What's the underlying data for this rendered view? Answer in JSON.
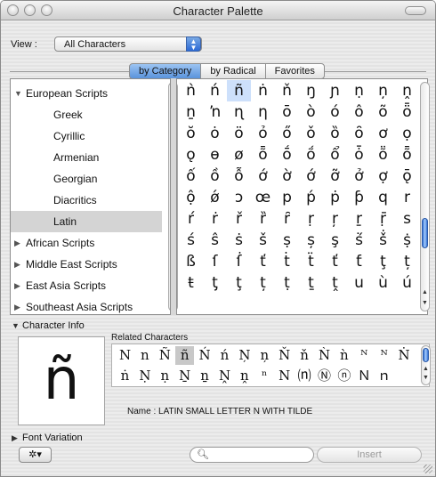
{
  "window": {
    "title": "Character Palette"
  },
  "view": {
    "label": "View :",
    "selected": "All Characters"
  },
  "tabs": [
    {
      "label": "by Category",
      "selected": true
    },
    {
      "label": "by Radical",
      "selected": false
    },
    {
      "label": "Favorites",
      "selected": false
    }
  ],
  "categories": [
    {
      "label": "European Scripts",
      "kind": "group",
      "expanded": true
    },
    {
      "label": "Greek",
      "kind": "child"
    },
    {
      "label": "Cyrillic",
      "kind": "child"
    },
    {
      "label": "Armenian",
      "kind": "child"
    },
    {
      "label": "Georgian",
      "kind": "child"
    },
    {
      "label": "Diacritics",
      "kind": "child"
    },
    {
      "label": "Latin",
      "kind": "child",
      "selected": true
    },
    {
      "label": "African Scripts",
      "kind": "group",
      "expanded": false
    },
    {
      "label": "Middle East Scripts",
      "kind": "group",
      "expanded": false
    },
    {
      "label": "East Asia Scripts",
      "kind": "group",
      "expanded": false
    },
    {
      "label": "Southeast Asia Scripts",
      "kind": "group",
      "expanded": false
    }
  ],
  "glyph_rows": [
    [
      "ǹ",
      "ń",
      "ñ",
      "ṅ",
      "ň",
      "ŋ",
      "ɲ",
      "ṇ",
      "ņ",
      "ṋ"
    ],
    [
      "ṉ",
      "ŉ",
      "ɳ",
      "ƞ",
      "ō",
      "ò",
      "ó",
      "ô",
      "õ",
      "ȫ"
    ],
    [
      "ŏ",
      "ȯ",
      "ö",
      "ỏ",
      "ő",
      "ǒ",
      "ȍ",
      "ȏ",
      "ơ",
      "ọ"
    ],
    [
      "ǫ",
      "ɵ",
      "ø",
      "ȭ",
      "ṓ",
      "ṍ",
      "ổ",
      "ȱ",
      "ṏ",
      "ȭ"
    ],
    [
      "ố",
      "ồ",
      "ỗ",
      "ớ",
      "ờ",
      "ớ",
      "ỡ",
      "ở",
      "ợ",
      "ǭ"
    ],
    [
      "ộ",
      "ǿ",
      "ɔ",
      "œ",
      "p",
      "ṕ",
      "ṗ",
      "ƥ",
      "q",
      "r"
    ],
    [
      "ŕ",
      "ṙ",
      "ř",
      "ȑ",
      "ȓ",
      "ṛ",
      "ŗ",
      "ṟ",
      "ṝ",
      "s"
    ],
    [
      "ś",
      "ŝ",
      "ṡ",
      "š",
      "ṣ",
      "ș",
      "ş",
      "ṥ",
      "ṧ",
      "ṩ"
    ],
    [
      "ß",
      "ſ",
      "ẛ",
      "ť",
      "ṫ",
      "ẗ",
      "ť",
      "ƭ",
      "ţ",
      "ț"
    ],
    [
      "ŧ",
      "ƫ",
      "ţ",
      "ț",
      "ṭ",
      "ṯ",
      "ṱ",
      "u",
      "ù",
      "ú"
    ]
  ],
  "selected_glyph": "ñ",
  "character_info": {
    "label": "Character Info",
    "big_char": "ñ",
    "related_label": "Related Characters",
    "related_rows": [
      [
        "N",
        "n",
        "Ñ",
        "ñ",
        "Ń",
        "ń",
        "Ņ",
        "ņ",
        "Ň",
        "ň",
        "Ǹ",
        "ǹ",
        "ᴺ",
        "ᴺ",
        "Ṅ"
      ],
      [
        "ṅ",
        "Ṇ",
        "ṇ",
        "Ṉ",
        "ṉ",
        "Ṋ",
        "ṋ",
        "ⁿ",
        "N",
        "⒩",
        "Ⓝ",
        "ⓝ",
        "Ｎ",
        "ｎ"
      ]
    ],
    "name_label": "Name :",
    "name_value": "LATIN SMALL LETTER N WITH TILDE"
  },
  "font_variation": {
    "label": "Font Variation"
  },
  "actions": {
    "gear_label": "✲▾",
    "search_icon": "search-icon",
    "insert_label": "Insert"
  },
  "colors": {
    "accent": "#5a93dc",
    "selection": "#cde0fb",
    "list_selection": "#d4d4d4"
  }
}
